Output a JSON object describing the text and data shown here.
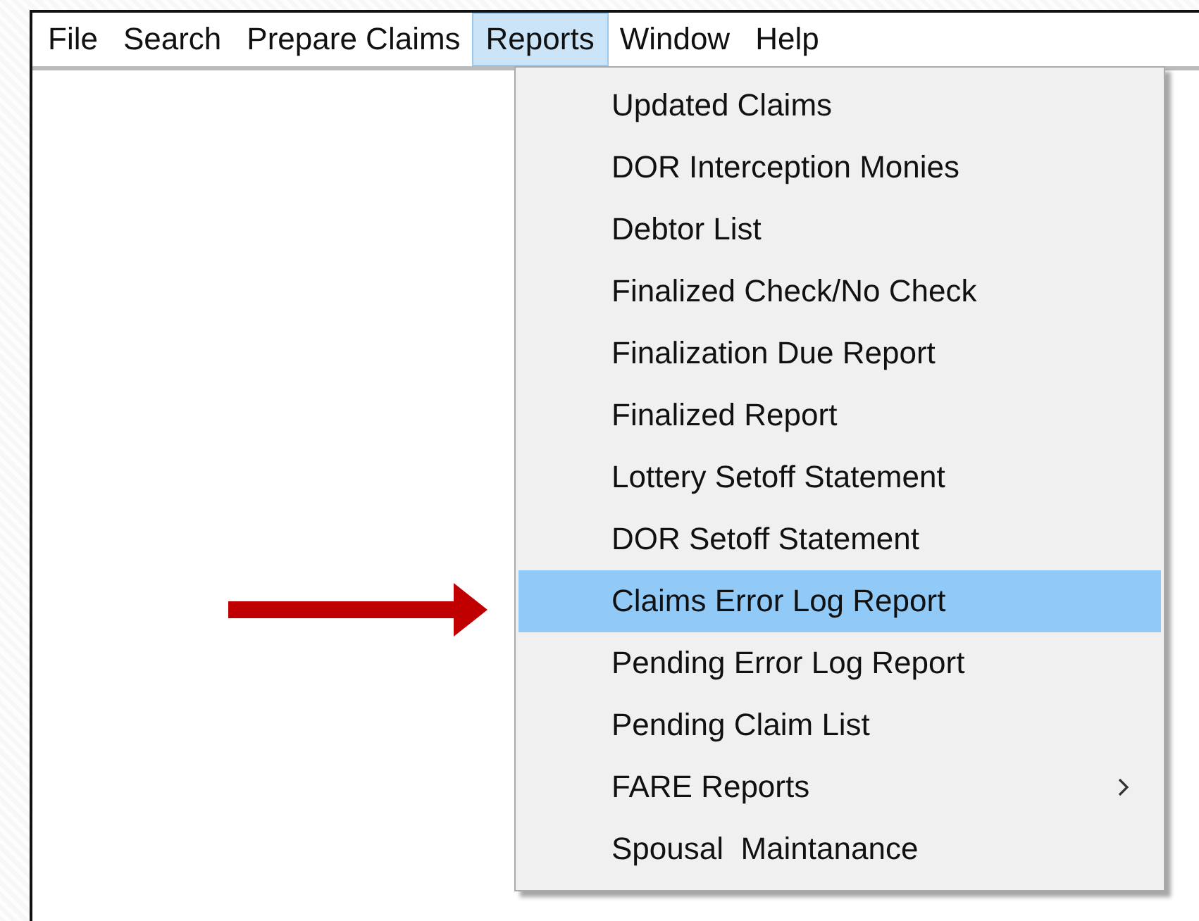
{
  "menu_bar": [
    {
      "label": "File",
      "selected": false
    },
    {
      "label": "Search",
      "selected": false
    },
    {
      "label": "Prepare Claims",
      "selected": false
    },
    {
      "label": "Reports",
      "selected": true
    },
    {
      "label": "Window",
      "selected": false
    },
    {
      "label": "Help",
      "selected": false
    }
  ],
  "dropdown": {
    "items": [
      {
        "label": "Updated Claims",
        "selected": false,
        "submenu": false
      },
      {
        "label": "DOR Interception Monies",
        "selected": false,
        "submenu": false
      },
      {
        "label": "Debtor List",
        "selected": false,
        "submenu": false
      },
      {
        "label": "Finalized Check/No Check",
        "selected": false,
        "submenu": false
      },
      {
        "label": "Finalization Due Report",
        "selected": false,
        "submenu": false
      },
      {
        "label": "Finalized Report",
        "selected": false,
        "submenu": false
      },
      {
        "label": "Lottery Setoff Statement",
        "selected": false,
        "submenu": false
      },
      {
        "label": "DOR Setoff Statement",
        "selected": false,
        "submenu": false
      },
      {
        "label": "Claims Error Log Report",
        "selected": true,
        "submenu": false
      },
      {
        "label": "Pending Error Log Report",
        "selected": false,
        "submenu": false
      },
      {
        "label": "Pending Claim List",
        "selected": false,
        "submenu": false
      },
      {
        "label": "FARE Reports",
        "selected": false,
        "submenu": true
      },
      {
        "label": "Spousal  Maintanance",
        "selected": false,
        "submenu": false
      }
    ]
  }
}
